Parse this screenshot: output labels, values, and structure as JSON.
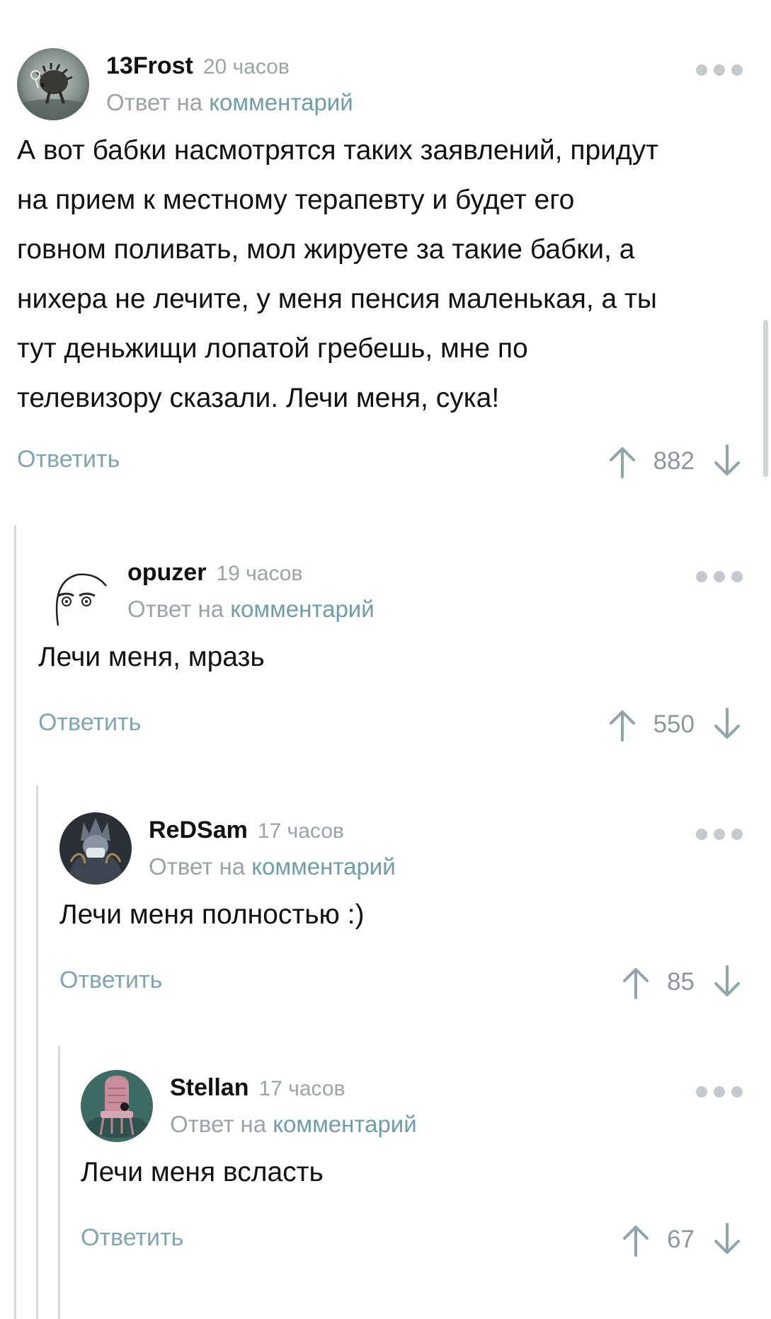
{
  "comments": [
    {
      "author": "13Frost",
      "time": "20 часов",
      "reply_prefix": "Ответ на",
      "reply_link": "комментарий",
      "lines": [
        "А вот бабки насмотрятся таких заявлений, придут",
        "на прием к местному терапевту и будет его",
        "говном поливать, мол жируете за такие бабки, а",
        "нихера не лечите, у меня пенсия маленькая, а ты",
        "тут деньжищи лопатой гребешь, мне по",
        "телевизору сказали. Лечи меня, сука!"
      ],
      "reply_label": "Ответить",
      "score": "882",
      "avatar_icon": "hedgehog-in-fog-avatar"
    },
    {
      "author": "opuzer",
      "time": "19 часов",
      "reply_prefix": "Ответ на",
      "reply_link": "комментарий",
      "lines": [
        "Лечи меня, мразь"
      ],
      "reply_label": "Ответить",
      "score": "550",
      "avatar_icon": "sketch-face-avatar"
    },
    {
      "author": "ReDSam",
      "time": "17 часов",
      "reply_prefix": "Ответ на",
      "reply_link": "комментарий",
      "lines": [
        "Лечи меня полностью :)"
      ],
      "reply_label": "Ответить",
      "score": "85",
      "avatar_icon": "masked-figure-avatar"
    },
    {
      "author": "Stellan",
      "time": "17 часов",
      "reply_prefix": "Ответ на",
      "reply_link": "комментарий",
      "lines": [
        "Лечи меня всласть"
      ],
      "reply_label": "Ответить",
      "score": "67",
      "avatar_icon": "throne-avatar"
    }
  ],
  "colors": {
    "accent": "#6c9eaa",
    "muted": "#9aa4a8",
    "reply_button": "#7ea6b0",
    "thread_rail": "#d6dbdd"
  },
  "icons": {
    "upvote": "arrow-up-icon",
    "downvote": "arrow-down-icon",
    "more": "more-dots-icon"
  }
}
